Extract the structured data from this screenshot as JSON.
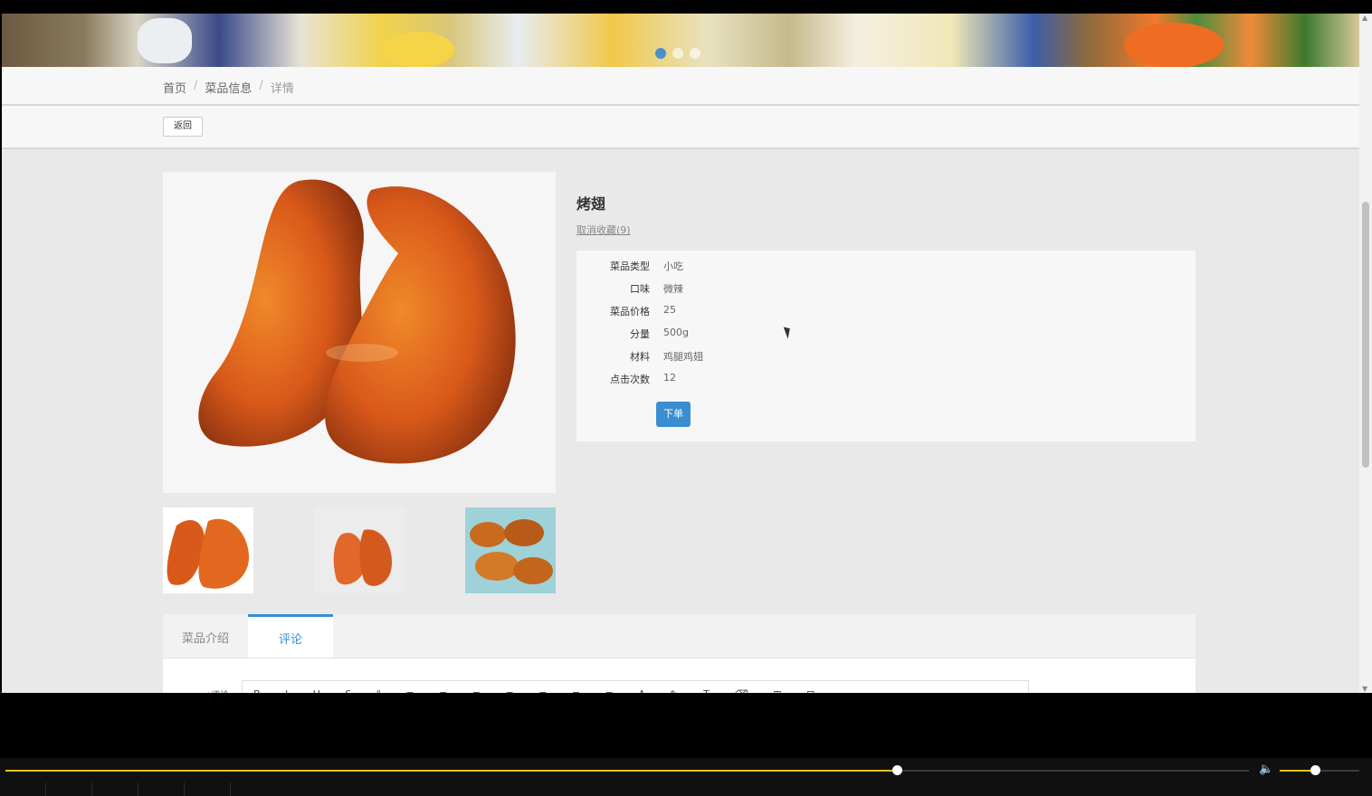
{
  "breadcrumb": {
    "home": "首页",
    "section": "菜品信息",
    "current": "详情",
    "separator": "/"
  },
  "toolbar": {
    "back_label": "返回"
  },
  "dish": {
    "name": "烤翅",
    "favorite_label": "取消收藏(9)",
    "fields": [
      {
        "label": "菜品类型",
        "value": "小吃"
      },
      {
        "label": "口味",
        "value": "微辣"
      },
      {
        "label": "菜品价格",
        "value": "25"
      },
      {
        "label": "分量",
        "value": "500g"
      },
      {
        "label": "材料",
        "value": "鸡腿鸡翅"
      },
      {
        "label": "点击次数",
        "value": "12"
      }
    ],
    "order_label": "下单"
  },
  "tabs": [
    {
      "label": "菜品介绍",
      "active": false
    },
    {
      "label": "评论",
      "active": true
    }
  ],
  "comment": {
    "label": "评论",
    "required_mark": "*",
    "toolbar_glyphs": "B I U S \" ≡ ≡ ≡ ≡ ≡ ≡ ≡ A ✎ T ⌫ ⊞ ⊟"
  },
  "banner": {
    "active_dot": 0,
    "dot_count": 3
  },
  "player": {
    "progress": 0.717,
    "volume": 0.44
  },
  "colors": {
    "accent": "#3a8ed0",
    "progress": "#e8c21a",
    "page_bg": "#e9e9e9"
  }
}
